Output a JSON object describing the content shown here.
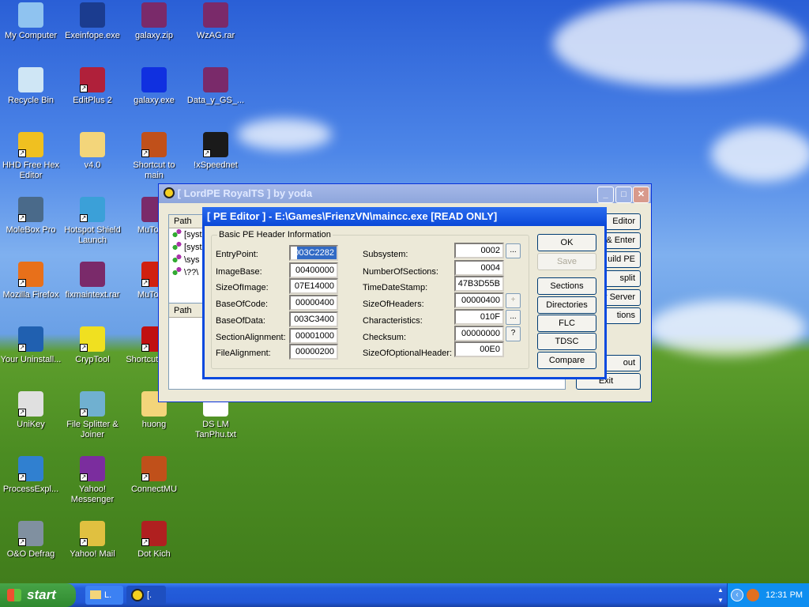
{
  "desktop": {
    "icons": [
      {
        "label": "My Computer",
        "icon": "computer-icon",
        "color": "#8fc3f0"
      },
      {
        "label": "Exeinfope.exe",
        "icon": "exe-icon",
        "color": "#1b3c8f"
      },
      {
        "label": "galaxy.zip",
        "icon": "winrar-archive-icon",
        "color": "#7a2a6a"
      },
      {
        "label": "WzAG.rar",
        "icon": "winrar-archive-icon",
        "color": "#7a2a6a"
      },
      {
        "label": "Recycle Bin",
        "icon": "recycle-bin-icon",
        "color": "#cfe6f5"
      },
      {
        "label": "EditPlus 2",
        "icon": "editplus-icon",
        "color": "#b0203a"
      },
      {
        "label": "galaxy.exe",
        "icon": "galaxy-exe-icon",
        "color": "#1030e0"
      },
      {
        "label": "Data_y_GS_...",
        "icon": "winrar-archive-icon",
        "color": "#7a2a6a"
      },
      {
        "label": "HHD Free Hex Editor",
        "icon": "hex-editor-icon",
        "color": "#f0c020"
      },
      {
        "label": "v4.0",
        "icon": "folder-icon",
        "color": "#f3d57a"
      },
      {
        "label": "Shortcut to main",
        "icon": "mu-icon",
        "color": "#c0501a"
      },
      {
        "label": "!xSpeednet",
        "icon": "speednet-icon",
        "color": "#1a1a1a"
      },
      {
        "label": "MoleBox Pro",
        "icon": "molebox-icon",
        "color": "#4a6a8a"
      },
      {
        "label": "Hotspot Shield Launch",
        "icon": "shield-icon",
        "color": "#3ba0d8"
      },
      {
        "label": "MuToolF",
        "icon": "winrar-archive-icon",
        "color": "#7a2a6a"
      },
      {
        "label": "Mozilla Firefox",
        "icon": "firefox-icon",
        "color": "#e8701a"
      },
      {
        "label": "fixmaintext.rar",
        "icon": "winrar-archive-icon",
        "color": "#7a2a6a"
      },
      {
        "label": "MuToolF",
        "icon": "mutool-icon",
        "color": "#d02010"
      },
      {
        "label": "Your Uninstall...",
        "icon": "uninstaller-icon",
        "color": "#2060b0"
      },
      {
        "label": "CrypTool",
        "icon": "cryptool-icon",
        "color": "#f0e020"
      },
      {
        "label": "Shortcut OLLY",
        "icon": "olly-icon",
        "color": "#c01010"
      },
      {
        "label": "UniKey",
        "icon": "unikey-icon",
        "color": "#e0e0e0"
      },
      {
        "label": "File Splitter & Joiner",
        "icon": "file-splitter-icon",
        "color": "#70b0d0"
      },
      {
        "label": "huong",
        "icon": "folder-icon",
        "color": "#f3d57a"
      },
      {
        "label": "DS LM TanPhu.txt",
        "icon": "text-file-icon",
        "color": "#ffffff"
      },
      {
        "label": "ProcessExpl...",
        "icon": "process-explorer-icon",
        "color": "#3080d0"
      },
      {
        "label": "Yahoo! Messenger",
        "icon": "yahoo-messenger-icon",
        "color": "#7b2d9e"
      },
      {
        "label": "ConnectMU",
        "icon": "mu-icon",
        "color": "#c0501a"
      },
      {
        "label": "O&O Defrag",
        "icon": "defrag-icon",
        "color": "#8090a0"
      },
      {
        "label": "Yahoo! Mail",
        "icon": "yahoo-mail-icon",
        "color": "#e0c040"
      },
      {
        "label": "Dot Kich",
        "icon": "crossfire-icon",
        "color": "#b02020"
      }
    ]
  },
  "lordpe": {
    "title": "[ LordPE RoyalTS ] by yoda",
    "path_header": "Path",
    "path_header2": "Path",
    "processes": [
      "[syst",
      "[syst",
      "\\sys",
      "\\??\\"
    ],
    "buttons": [
      "Editor",
      "& Enter",
      "uild PE",
      "split",
      "er Server",
      "tions",
      "out",
      "Exit"
    ]
  },
  "pe_editor": {
    "title": "[ PE Editor ] - E:\\Games\\FrienzVN\\maincc.exe [READ ONLY]",
    "group_label": "Basic PE Header Information",
    "left_fields": [
      {
        "label": "EntryPoint:",
        "value": "003C2282"
      },
      {
        "label": "ImageBase:",
        "value": "00400000"
      },
      {
        "label": "SizeOfImage:",
        "value": "07E14000"
      },
      {
        "label": "BaseOfCode:",
        "value": "00000400"
      },
      {
        "label": "BaseOfData:",
        "value": "003C3400"
      },
      {
        "label": "SectionAlignment:",
        "value": "00001000"
      },
      {
        "label": "FileAlignment:",
        "value": "00000200"
      }
    ],
    "right_fields": [
      {
        "label": "Subsystem:",
        "value": "0002",
        "button": "..."
      },
      {
        "label": "NumberOfSections:",
        "value": "0004"
      },
      {
        "label": "TimeDateStamp:",
        "value": "47B3D55B"
      },
      {
        "label": "SizeOfHeaders:",
        "value": "00000400",
        "button": "+"
      },
      {
        "label": "Characteristics:",
        "value": "010F",
        "button": "..."
      },
      {
        "label": "Checksum:",
        "value": "00000000",
        "button": "?"
      },
      {
        "label": "SizeOfOptionalHeader:",
        "value": "00E0"
      }
    ],
    "buttons": {
      "ok": "OK",
      "save": "Save",
      "sections": "Sections",
      "directories": "Directories",
      "flc": "FLC",
      "tdsc": "TDSC",
      "compare": "Compare"
    }
  },
  "taskbar": {
    "start": "start",
    "tasks": [
      "L.",
      "[."
    ],
    "clock": "12:31 PM"
  }
}
